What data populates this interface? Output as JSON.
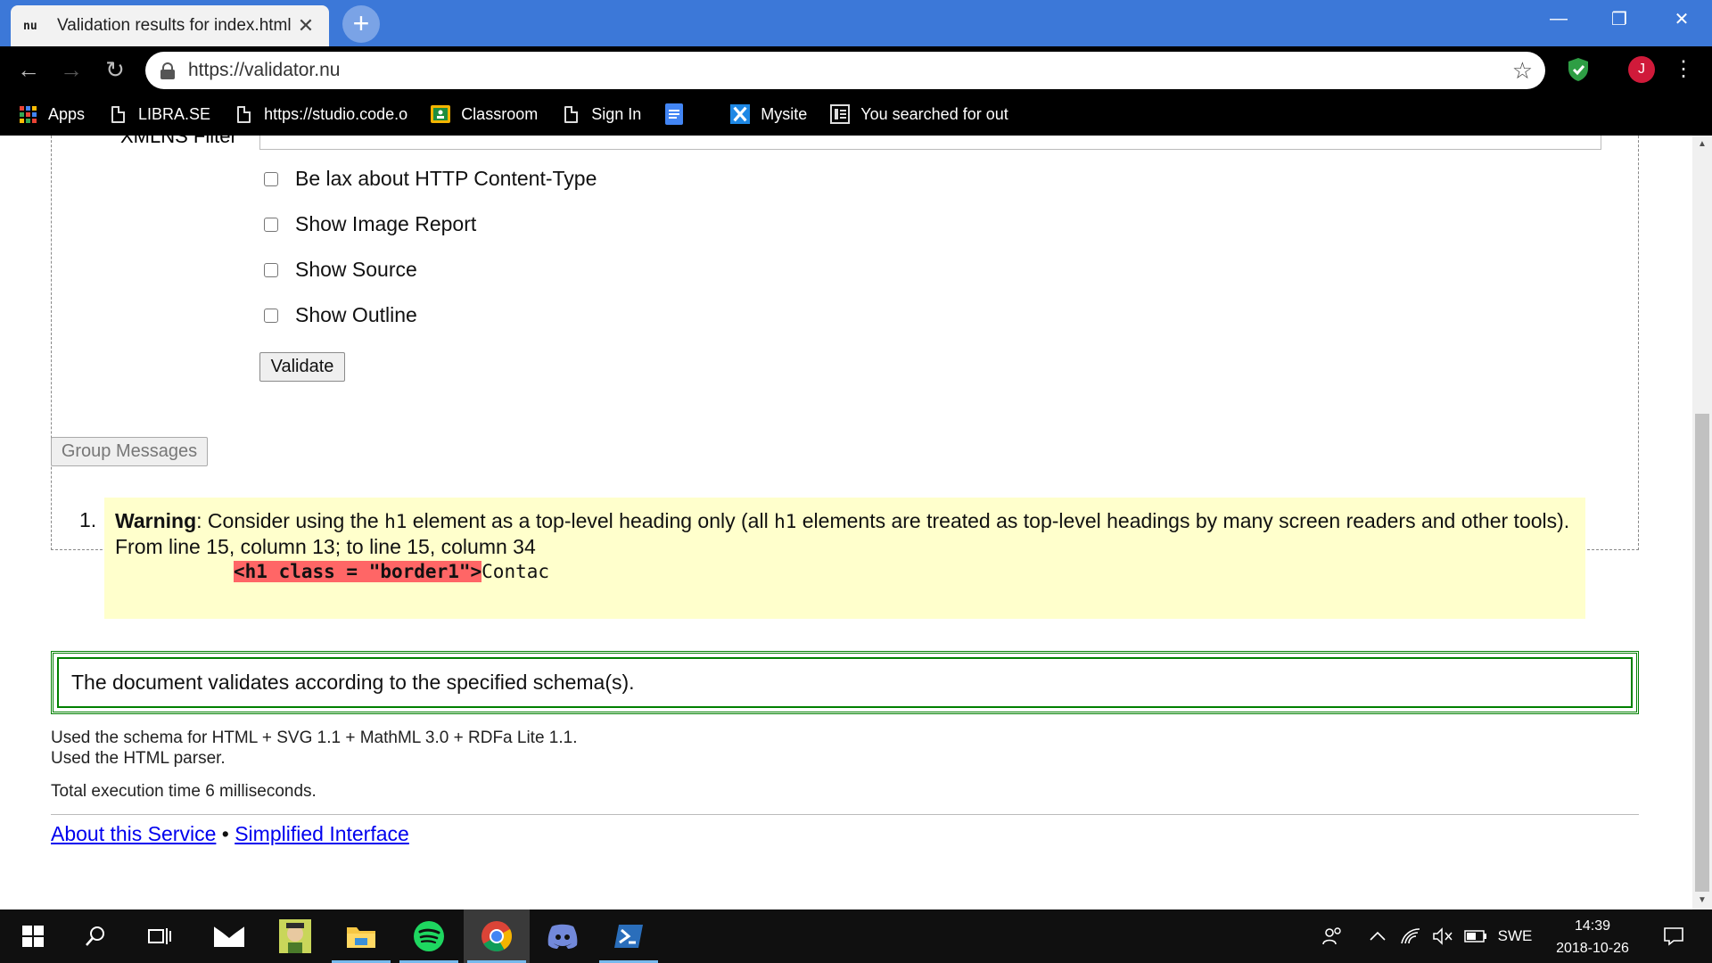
{
  "browser": {
    "tab": {
      "favicon_text": "nu",
      "title": "Validation results for index.html"
    },
    "url": "https://validator.nu",
    "avatar_letter": "J"
  },
  "bookmarks": [
    {
      "label": "Apps",
      "icon": "apps-grid-icon"
    },
    {
      "label": "LIBRA.SE",
      "icon": "page-icon"
    },
    {
      "label": "https://studio.code.o",
      "icon": "page-icon"
    },
    {
      "label": "Classroom",
      "icon": "classroom-icon"
    },
    {
      "label": "Sign In",
      "icon": "page-icon"
    },
    {
      "label": "",
      "icon": "docs-icon"
    },
    {
      "label": "Mysite",
      "icon": "mysite-icon"
    },
    {
      "label": "You searched for out",
      "icon": "search-result-icon"
    }
  ],
  "form": {
    "xmlns_label": "XMLNS Filter",
    "options": [
      {
        "label": "Be lax about HTTP Content-Type",
        "checked": false
      },
      {
        "label": "Show Image Report",
        "checked": false
      },
      {
        "label": "Show Source",
        "checked": false
      },
      {
        "label": "Show Outline",
        "checked": false
      }
    ],
    "validate_label": "Validate"
  },
  "group_messages_label": "Group Messages",
  "message": {
    "number": "1.",
    "type": "Warning",
    "text_a": ": Consider using the ",
    "code_a": "h1",
    "text_b": " element as a top-level heading only (all ",
    "code_b": "h1",
    "text_c": " elements are treated as top-level headings by many screen readers and other tools).",
    "location": "From line 15, column 13; to line 15, column 34",
    "extract_highlight": "<h1 class = \"border1\">",
    "extract_rest": "Contac"
  },
  "success_text": "The document validates according to the specified schema(s).",
  "details": {
    "schema": "Used the schema for HTML + SVG 1.1 + MathML 3.0 + RDFa Lite 1.1.",
    "parser": "Used the HTML parser.",
    "time": "Total execution time 6 milliseconds."
  },
  "footer": {
    "about": "About this Service",
    "separator": "•",
    "simplified": "Simplified Interface"
  },
  "taskbar": {
    "language": "SWE",
    "time": "14:39",
    "date": "2018-10-26"
  },
  "colors": {
    "tabstrip": "#3c78d8",
    "warning_bg": "#ffffcc",
    "extract_highlight": "#ff6666",
    "success_border": "#008000",
    "link": "#0000ee"
  }
}
